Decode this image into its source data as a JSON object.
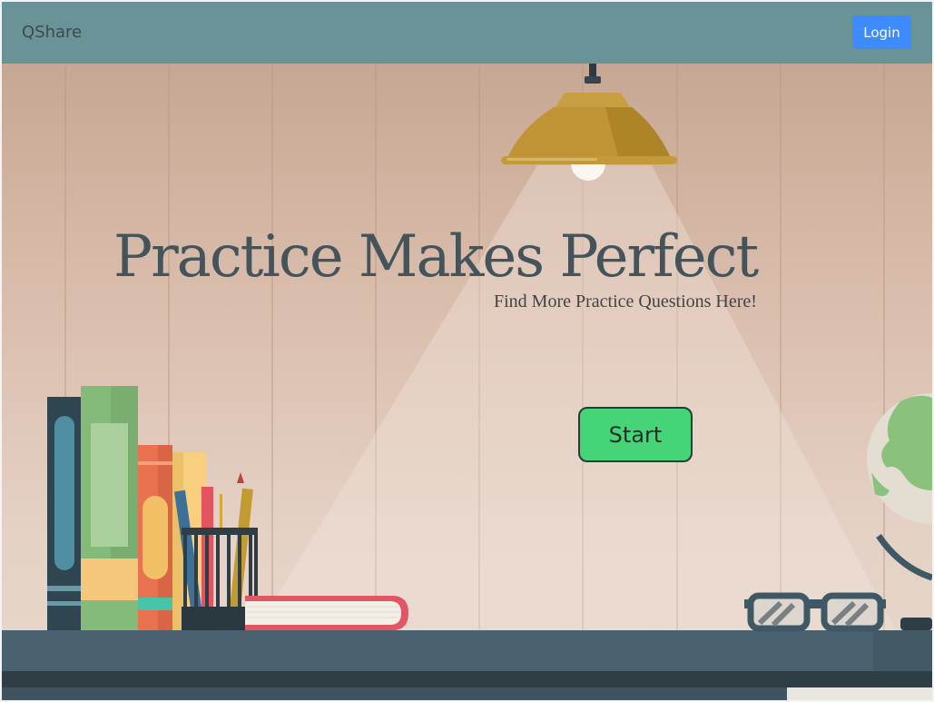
{
  "navbar": {
    "brand": "QShare",
    "login_label": "Login"
  },
  "hero": {
    "headline": "Practice Makes Perfect",
    "subline": "Find More Practice Questions Here!",
    "start_label": "Start"
  },
  "colors": {
    "navbar_bg": "#6a9398",
    "login_button": "#3d8bff",
    "start_button": "#45d477",
    "headline_text": "#45545a"
  },
  "icons": [
    "lamp-icon",
    "books-icon",
    "pencil-cup-icon",
    "glasses-icon",
    "globe-icon"
  ]
}
